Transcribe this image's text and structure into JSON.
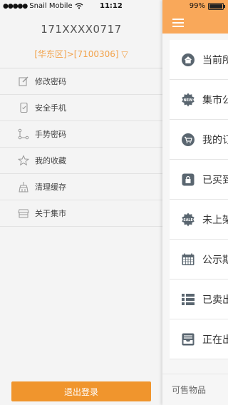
{
  "status_bar": {
    "carrier": "Snail Mobile",
    "time": "11:12",
    "battery_percent": "99%",
    "battery_level": 0.99
  },
  "drawer": {
    "phone": "171XXXX0717",
    "region": "[华东区]>[7100306] ▽",
    "menu": [
      {
        "label": "修改密码",
        "icon": "edit-icon"
      },
      {
        "label": "安全手机",
        "icon": "phone-icon"
      },
      {
        "label": "手势密码",
        "icon": "gesture-icon"
      },
      {
        "label": "我的收藏",
        "icon": "star-icon"
      },
      {
        "label": "清理缓存",
        "icon": "broom-icon"
      },
      {
        "label": "关于集市",
        "icon": "store-icon"
      }
    ],
    "logout_label": "退出登录"
  },
  "main": {
    "nav": [
      {
        "label": "当前所",
        "icon": "home-icon"
      },
      {
        "label": "集市公",
        "icon": "new-badge-icon"
      },
      {
        "label": "我的订",
        "icon": "cart-icon"
      },
      {
        "label": "已买到",
        "icon": "lock-icon"
      },
      {
        "label": "未上架",
        "icon": "sale-badge-icon"
      },
      {
        "label": "公示期",
        "icon": "calendar-icon"
      },
      {
        "label": "已卖出",
        "icon": "list-icon"
      },
      {
        "label": "正在出",
        "icon": "inbox-icon"
      }
    ],
    "bottom_tab": "可售物品"
  },
  "colors": {
    "accent": "#f0952d",
    "topbar": "#f9a85a",
    "region_text": "#f2a24a",
    "icon_dark": "#5a6670"
  }
}
